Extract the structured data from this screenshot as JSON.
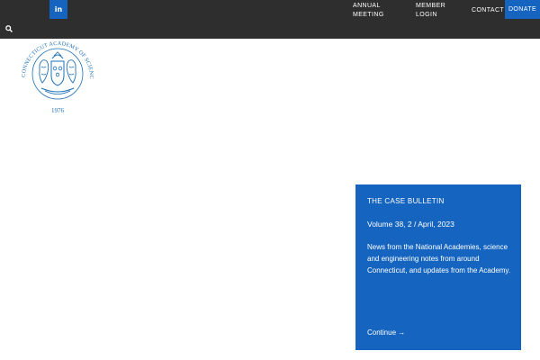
{
  "header": {
    "social": {
      "linkedin_label": "in"
    },
    "nav": {
      "annual_meeting": "ANNUAL\nMEETING",
      "member_login": "MEMBER\nLOGIN",
      "contact": "CONTACT",
      "donate": "DONATE"
    },
    "search_icon": "search-icon"
  },
  "logo": {
    "ring_text": "CONNECTICUT ACADEMY OF SCIENCE AND ENGINEERING",
    "year_text": "1976",
    "color": "#1e6fb3"
  },
  "promo": {
    "label": "THE CASE BULLETIN",
    "issue": "Volume 38, 2 / April, 2023",
    "description": "News from the National Academies, science and engineering notes from around Connecticut, and updates from the Academy.",
    "link": "Continue →",
    "bg_color": "#1565c0"
  },
  "colors": {
    "topbar": "#2e2e2e",
    "accent": "#1565c0"
  }
}
